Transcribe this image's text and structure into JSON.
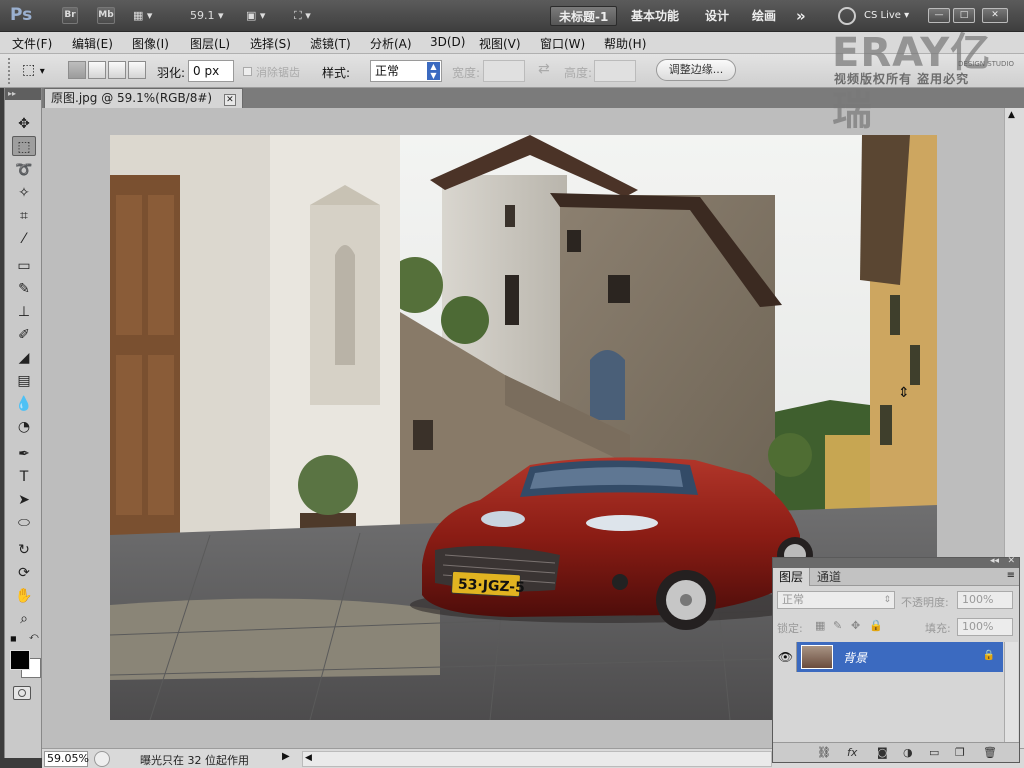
{
  "app": {
    "logo": "Ps",
    "bridge_label": "Br",
    "minibridge_label": "Mb",
    "zoom_value": "59.1",
    "workspaces": [
      "未标题-1",
      "基本功能",
      "设计",
      "绘画"
    ],
    "more": "»",
    "cs_live": "CS Live",
    "win_controls": [
      "—",
      "□",
      "✕"
    ]
  },
  "menu": [
    "文件(F)",
    "编辑(E)",
    "图像(I)",
    "图层(L)",
    "选择(S)",
    "滤镜(T)",
    "分析(A)",
    "3D(D)",
    "视图(V)",
    "窗口(W)",
    "帮助(H)"
  ],
  "options": {
    "feather_label": "羽化:",
    "feather_value": "0 px",
    "antialias_label": "消除锯齿",
    "style_label": "样式:",
    "style_value": "正常",
    "width_label": "宽度:",
    "height_label": "高度:",
    "refine_edge_button": "调整边缘..."
  },
  "document": {
    "tab_title": "原图.jpg @ 59.1%(RGB/8#)",
    "plate_text": "53·JGZ-5"
  },
  "status": {
    "zoom": "59.05%",
    "message": "曝光只在 32 位起作用"
  },
  "watermark": {
    "brand": "ERAY亿瑞",
    "sub": "视频版权所有 盗用必究",
    "design": "DESIGN STUDIO"
  },
  "layers_panel": {
    "tabs": [
      "图层",
      "通道"
    ],
    "blend_mode": "正常",
    "opacity_label": "不透明度:",
    "opacity_value": "100%",
    "lock_label": "锁定:",
    "fill_label": "填充:",
    "fill_value": "100%",
    "layer_name": "背景"
  },
  "colors": {
    "accent": "#3b6ac0",
    "car": "#8a1c14"
  }
}
